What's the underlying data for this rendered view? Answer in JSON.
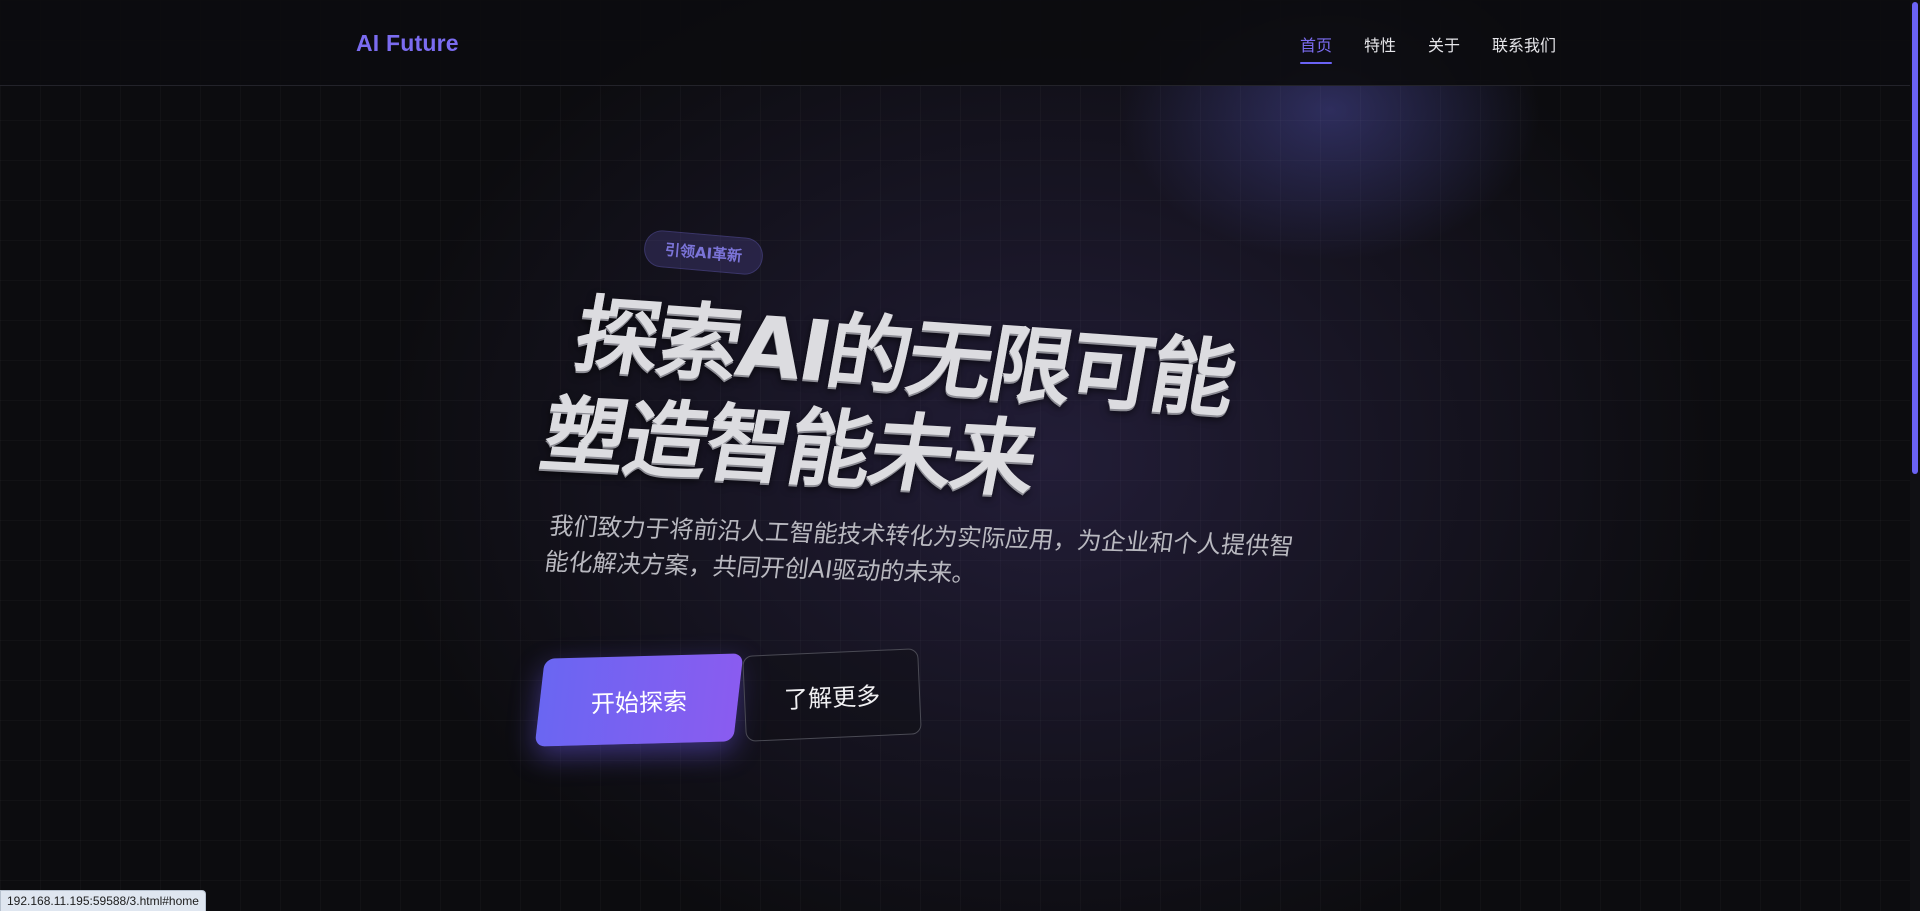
{
  "header": {
    "logo": "AI Future",
    "nav": [
      {
        "label": "首页",
        "active": true
      },
      {
        "label": "特性",
        "active": false
      },
      {
        "label": "关于",
        "active": false
      },
      {
        "label": "联系我们",
        "active": false
      }
    ]
  },
  "hero": {
    "badge": "引领AI革新",
    "title_line_1": "探索AI的无限可能",
    "title_line_2": "塑造智能未来",
    "description": "我们致力于将前沿人工智能技术转化为实际应用，为企业和个人提供智能化解决方案，共同开创AI驱动的未来。",
    "primary_button": "开始探索",
    "secondary_button": "了解更多"
  },
  "browser": {
    "status_url": "192.168.11.195:59588/3.html#home"
  },
  "colors": {
    "accent": "#7b6cf0",
    "button_gradient_start": "#6a66f2",
    "button_gradient_end": "#8a5cf0",
    "background": "#0c0c0f"
  }
}
